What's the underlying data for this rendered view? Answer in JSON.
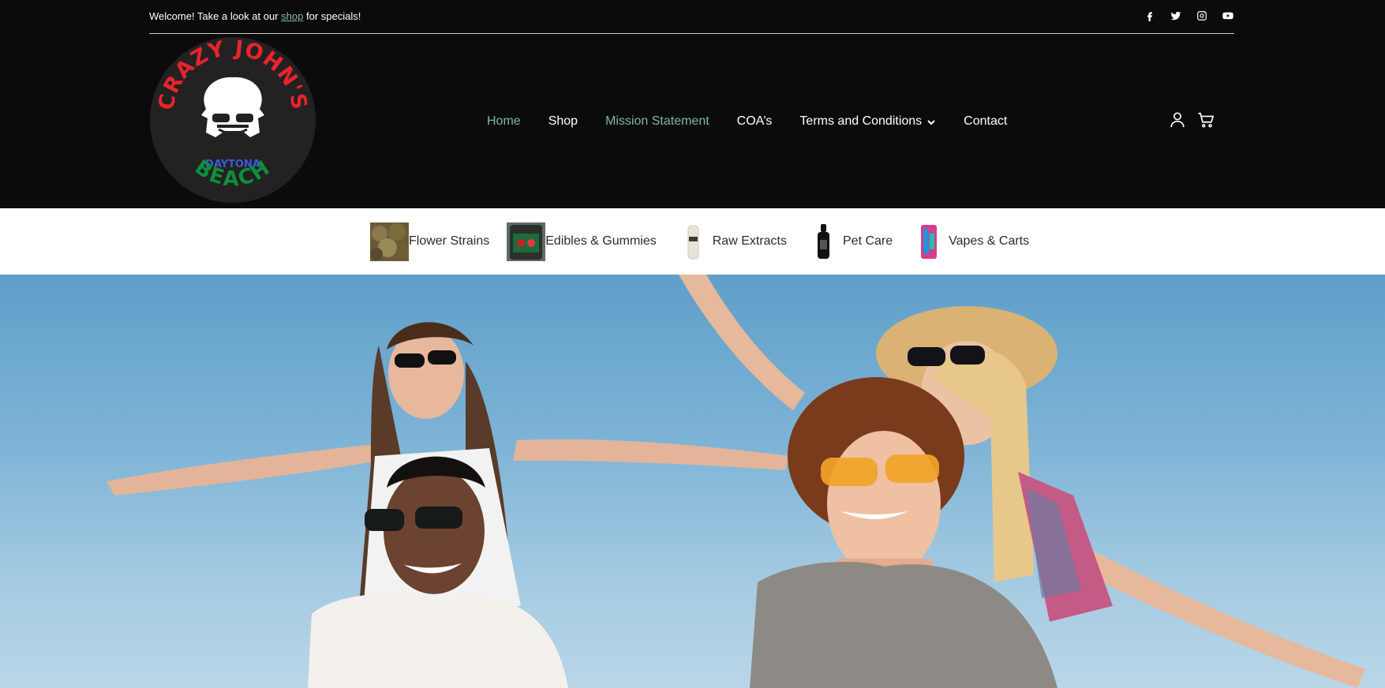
{
  "topbar": {
    "welcome_prefix": "Welcome! Take a look at our ",
    "welcome_link": "shop",
    "welcome_suffix": " for specials!",
    "socials": [
      "facebook-icon",
      "twitter-icon",
      "instagram-icon",
      "youtube-icon"
    ]
  },
  "logo": {
    "top_text": "CRAZY JOHN'S",
    "middle_text": "DAYTONA",
    "bottom_text": "BEACH"
  },
  "nav": {
    "items": [
      {
        "label": "Home",
        "active": true
      },
      {
        "label": "Shop"
      },
      {
        "label": "Mission Statement",
        "accent": true
      },
      {
        "label": "COA’s"
      },
      {
        "label": "Terms and Conditions",
        "has_dropdown": true
      },
      {
        "label": "Contact"
      }
    ],
    "icons": [
      "user-account-icon",
      "shopping-cart-icon"
    ]
  },
  "categories": [
    {
      "label": "Flower Strains"
    },
    {
      "label": "Edibles & Gummies"
    },
    {
      "label": "Raw Extracts"
    },
    {
      "label": "Pet Care"
    },
    {
      "label": "Vapes & Carts"
    }
  ],
  "colors": {
    "background": "#0c0b0c",
    "accent": "#7fb8a6",
    "logo_red": "#e8242c",
    "logo_blue": "#3a5bd9",
    "logo_green": "#0d8f3a"
  }
}
